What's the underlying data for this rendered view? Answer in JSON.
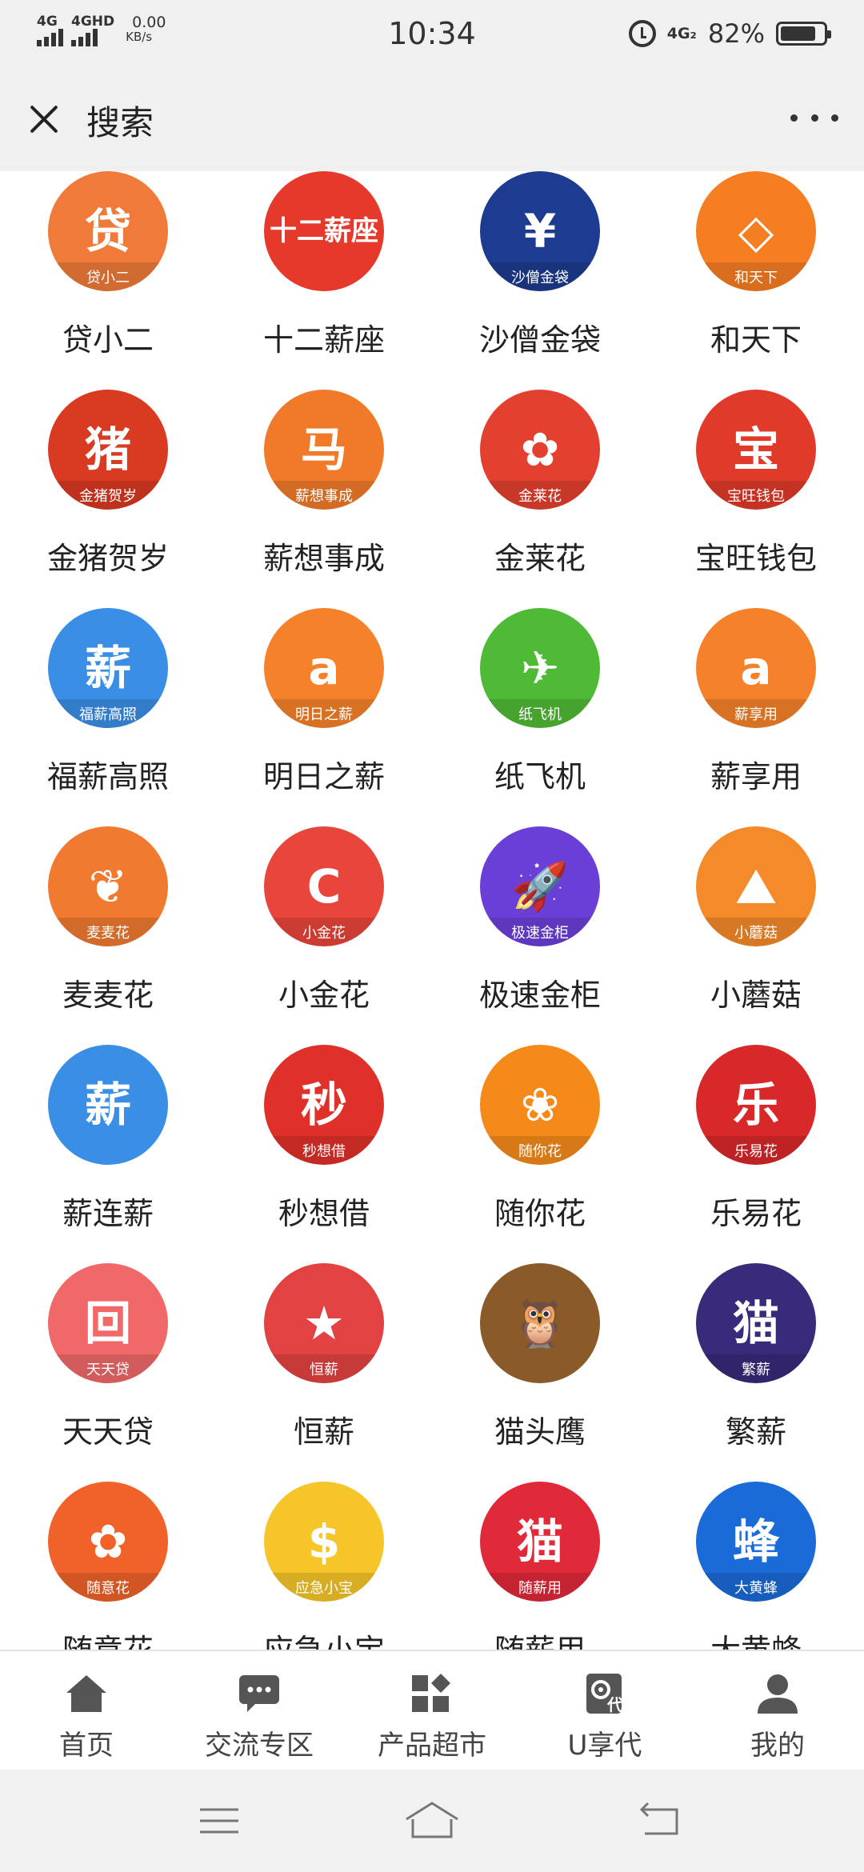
{
  "status_bar": {
    "signal1_label": "4G",
    "signal2_label": "4GHD",
    "net_speed": "0.00",
    "net_unit": "KB/s",
    "time": "10:34",
    "net_type": "4G₂",
    "battery_pct": "82%",
    "battery_level": 0.82
  },
  "header": {
    "title": "搜索"
  },
  "apps": [
    {
      "name": "贷小二",
      "icon_text": "贷",
      "band": "贷小二",
      "bg": "#f07a3a"
    },
    {
      "name": "十二薪座",
      "icon_text": "十二薪座",
      "band": "",
      "bg": "#e53a2b"
    },
    {
      "name": "沙僧金袋",
      "icon_text": "¥",
      "band": "沙僧金袋",
      "bg": "#1d3c8f"
    },
    {
      "name": "和天下",
      "icon_text": "◇",
      "band": "和天下",
      "bg": "#f57d22"
    },
    {
      "name": "金猪贺岁",
      "icon_text": "猪",
      "band": "金猪贺岁",
      "bg": "#d93a22"
    },
    {
      "name": "薪想事成",
      "icon_text": "马",
      "band": "薪想事成",
      "bg": "#f07a2a"
    },
    {
      "name": "金莱花",
      "icon_text": "✿",
      "band": "金莱花",
      "bg": "#e4402f"
    },
    {
      "name": "宝旺钱包",
      "icon_text": "宝",
      "band": "宝旺钱包",
      "bg": "#e03a2a"
    },
    {
      "name": "福薪高照",
      "icon_text": "薪",
      "band": "福薪高照",
      "bg": "#3a8ee6"
    },
    {
      "name": "明日之薪",
      "icon_text": "a",
      "band": "明日之薪",
      "bg": "#f5822a"
    },
    {
      "name": "纸飞机",
      "icon_text": "✈",
      "band": "纸飞机",
      "bg": "#4fba35"
    },
    {
      "name": "薪享用",
      "icon_text": "a",
      "band": "薪享用",
      "bg": "#f5822a"
    },
    {
      "name": "麦麦花",
      "icon_text": "❦",
      "band": "麦麦花",
      "bg": "#f07a30"
    },
    {
      "name": "小金花",
      "icon_text": "C",
      "band": "小金花",
      "bg": "#e8463a"
    },
    {
      "name": "极速金柜",
      "icon_text": "🚀",
      "band": "极速金柜",
      "bg": "#6a3fd8"
    },
    {
      "name": "小蘑菇",
      "icon_text": "⛰",
      "band": "小蘑菇",
      "bg": "#f58a2a"
    },
    {
      "name": "薪连薪",
      "icon_text": "薪",
      "band": "",
      "bg": "#3a8ee6"
    },
    {
      "name": "秒想借",
      "icon_text": "秒",
      "band": "秒想借",
      "bg": "#e0302a"
    },
    {
      "name": "随你花",
      "icon_text": "❀",
      "band": "随你花",
      "bg": "#f58a1a"
    },
    {
      "name": "乐易花",
      "icon_text": "乐",
      "band": "乐易花",
      "bg": "#d8282a"
    },
    {
      "name": "天天贷",
      "icon_text": "回",
      "band": "天天贷",
      "bg": "#f06868"
    },
    {
      "name": "恒薪",
      "icon_text": "★",
      "band": "恒薪",
      "bg": "#e24242"
    },
    {
      "name": "猫头鹰",
      "icon_text": "🦉",
      "band": "",
      "bg": "#8a5a28"
    },
    {
      "name": "繁薪",
      "icon_text": "猫",
      "band": "繁薪",
      "bg": "#3a2a7a"
    },
    {
      "name": "随意花",
      "icon_text": "✿",
      "band": "随意花",
      "bg": "#f0622a"
    },
    {
      "name": "应急小宝",
      "icon_text": "$",
      "band": "应急小宝",
      "bg": "#f5c52a"
    },
    {
      "name": "随薪用",
      "icon_text": "猫",
      "band": "随薪用",
      "bg": "#e02a3a"
    },
    {
      "name": "大黄蜂",
      "icon_text": "蜂",
      "band": "大黄蜂",
      "bg": "#1a6ad8"
    }
  ],
  "bottom_nav": [
    {
      "label": "首页",
      "icon": "home-icon"
    },
    {
      "label": "交流专区",
      "icon": "chat-icon"
    },
    {
      "label": "产品超市",
      "icon": "apps-icon"
    },
    {
      "label": "U享代",
      "icon": "gear-doc-icon"
    },
    {
      "label": "我的",
      "icon": "person-icon"
    }
  ],
  "system_nav": {
    "buttons": [
      "menu-icon",
      "home-icon",
      "back-icon"
    ]
  }
}
